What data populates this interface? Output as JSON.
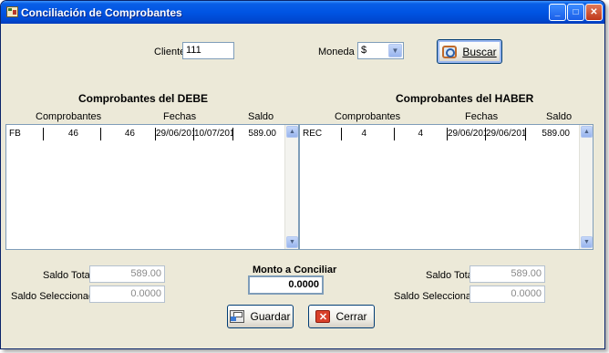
{
  "window": {
    "title": "Conciliación de Comprobantes",
    "min_glyph": "_",
    "max_glyph": "□",
    "close_glyph": "✕"
  },
  "filters": {
    "cliente_label": "Cliente",
    "cliente_value": "111",
    "moneda_label": "Moneda",
    "moneda_value": "$",
    "buscar_label": "Buscar"
  },
  "debe": {
    "title": "Comprobantes del DEBE",
    "headers": {
      "comprobantes": "Comprobantes",
      "fechas": "Fechas",
      "saldo": "Saldo"
    },
    "rows": [
      {
        "tipo": "FB",
        "letra": "",
        "numero": "46",
        "numero2": "46",
        "fecha1": "29/06/201",
        "fecha2": "10/07/201",
        "saldo": "589.00"
      }
    ]
  },
  "haber": {
    "title": "Comprobantes del HABER",
    "headers": {
      "comprobantes": "Comprobantes",
      "fechas": "Fechas",
      "saldo": "Saldo"
    },
    "rows": [
      {
        "tipo": "REC",
        "letra": "",
        "numero": "4",
        "numero2": "4",
        "fecha1": "29/06/201",
        "fecha2": "29/06/201",
        "saldo": "589.00"
      }
    ]
  },
  "totals_left": {
    "saldo_total_label": "Saldo Total",
    "saldo_total_value": "589.00",
    "saldo_sel_label": "Saldo Seleccionado",
    "saldo_sel_value": "0.0000"
  },
  "monto": {
    "label": "Monto a Conciliar",
    "value": "0.0000"
  },
  "totals_right": {
    "saldo_total_label": "Saldo Total",
    "saldo_total_value": "589.00",
    "saldo_sel_label": "Saldo Seleccionado",
    "saldo_sel_value": "0.0000"
  },
  "actions": {
    "guardar_label": "Guardar",
    "cerrar_label": "Cerrar"
  },
  "icons": {
    "app": "app-icon",
    "scroll_up": "▲",
    "scroll_down": "▼",
    "dropdown": "▼",
    "close_x": "✕"
  }
}
